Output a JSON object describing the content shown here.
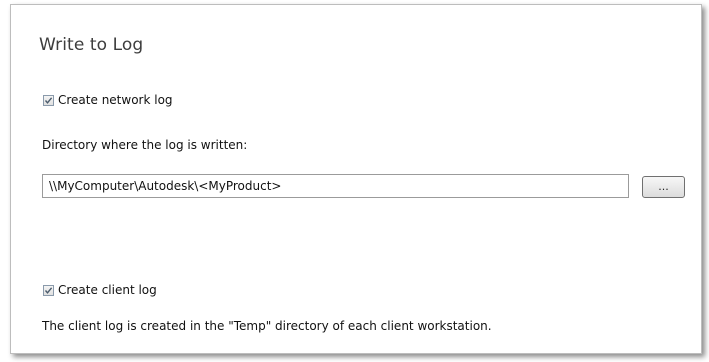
{
  "panel": {
    "title": "Write to Log"
  },
  "network_log": {
    "checkbox_label": "Create network log",
    "checked": true,
    "directory_label": "Directory where the log is written:",
    "directory_value": "\\\\MyComputer\\Autodesk\\<MyProduct>",
    "browse_label": "..."
  },
  "client_log": {
    "checkbox_label": "Create client log",
    "checked": true,
    "note": "The client log is created in the \"Temp\" directory of each client workstation."
  },
  "colors": {
    "title": "#3d3d3d",
    "panel_border": "#bdbdbd",
    "checkmark": "#4a5b6c"
  }
}
